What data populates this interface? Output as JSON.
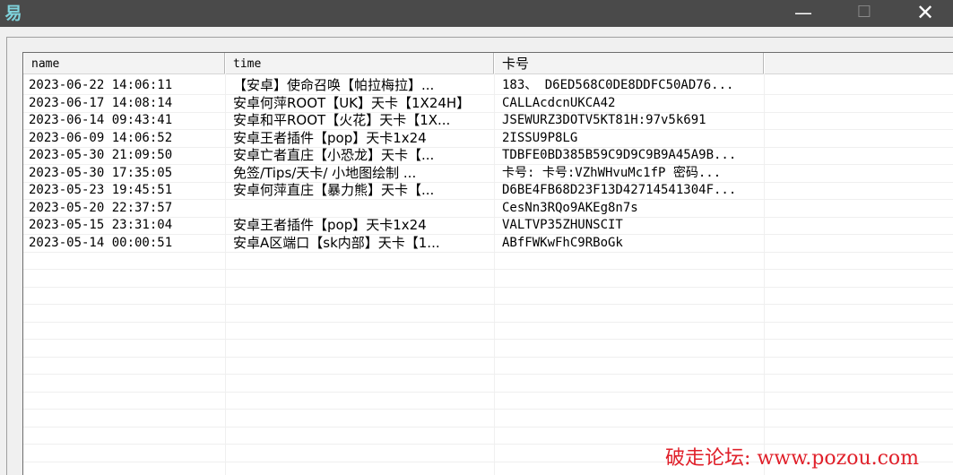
{
  "window": {
    "app_icon_glyph": "易",
    "minimize_glyph": "—",
    "maximize_glyph": "☐",
    "close_glyph": "✕"
  },
  "table": {
    "columns": [
      "name",
      "time",
      "卡号",
      ""
    ],
    "rows": [
      [
        "2023-06-22 14:06:11",
        "【安卓】使命召唤【帕拉梅拉】...",
        "183、 D6ED568C0DE8DDFC50AD76..."
      ],
      [
        "2023-06-17 14:08:14",
        "安卓何萍ROOT【UK】天卡【1X24H】",
        "CALLAcdcnUKCA42"
      ],
      [
        "2023-06-14 09:43:41",
        "安卓和平ROOT【火花】天卡【1X...",
        "JSEWURZ3DOTV5KT81H:97v5k691"
      ],
      [
        "2023-06-09 14:06:52",
        "安卓王者插件【pop】天卡1x24",
        "2ISSU9P8LG"
      ],
      [
        "2023-05-30 21:09:50",
        "安卓亡者直庄【小恐龙】天卡【...",
        "TDBFE0BD385B59C9D9C9B9A45A9B..."
      ],
      [
        "2023-05-30 17:35:05",
        "免签/Tips/天卡/ 小地图绘制 ...",
        "卡号: 卡号:VZhWHvuMc1fP 密码..."
      ],
      [
        "2023-05-23 19:45:51",
        "安卓何萍直庄【暴力熊】天卡【...",
        "D6BE4FB68D23F13D42714541304F..."
      ],
      [
        "2023-05-20 22:37:57",
        "",
        "CesNn3RQo9AKEg8n7s"
      ],
      [
        "2023-05-15 23:31:04",
        "安卓王者插件【pop】天卡1x24",
        "VALTVP35ZHUNSCIT"
      ],
      [
        "2023-05-14 00:00:51",
        "安卓A区端口【sk内部】天卡【1...",
        "ABfFWKwFhC9RBoGk"
      ]
    ]
  },
  "watermark": "破走论坛: www.pozou.com",
  "colors": {
    "titlebar": "#4a4a4a",
    "watermark": "#e0202a"
  }
}
